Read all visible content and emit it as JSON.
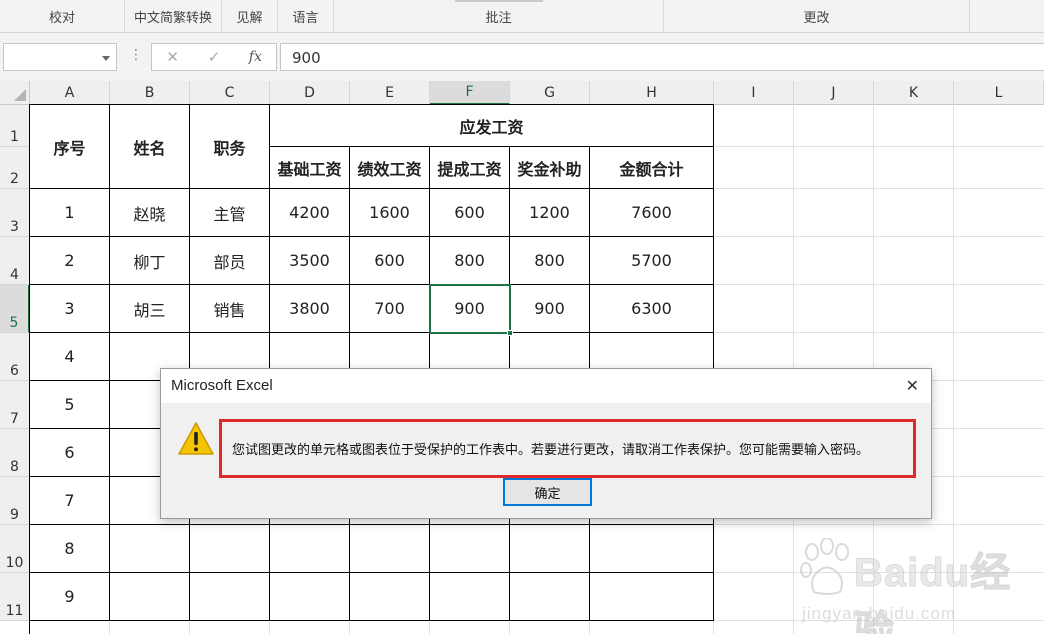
{
  "ribbon": {
    "groups": [
      "校对",
      "中文简繁转换",
      "见解",
      "语言",
      "批注",
      "更改"
    ]
  },
  "formula_bar": {
    "name_box": "",
    "cancel_symbol": "✕",
    "enter_symbol": "✓",
    "fx_symbol": "fx",
    "value": "900"
  },
  "columns": [
    "A",
    "B",
    "C",
    "D",
    "E",
    "F",
    "G",
    "H",
    "I",
    "J",
    "K",
    "L"
  ],
  "rows": [
    "1",
    "2",
    "3",
    "4",
    "5",
    "6",
    "7",
    "8",
    "9",
    "10",
    "11"
  ],
  "active_cell": {
    "column": "F",
    "row": "5"
  },
  "table": {
    "headers": {
      "seq": "序号",
      "name": "姓名",
      "role": "职务",
      "pay_group": "应发工资",
      "base": "基础工资",
      "perf": "绩效工资",
      "commission": "提成工资",
      "bonus": "奖金补助",
      "total": "金额合计"
    },
    "records": [
      {
        "seq": "1",
        "name": "赵晓",
        "role": "主管",
        "base": "4200",
        "perf": "1600",
        "commission": "600",
        "bonus": "1200",
        "total": "7600"
      },
      {
        "seq": "2",
        "name": "柳丁",
        "role": "部员",
        "base": "3500",
        "perf": "600",
        "commission": "800",
        "bonus": "800",
        "total": "5700"
      },
      {
        "seq": "3",
        "name": "胡三",
        "role": "销售",
        "base": "3800",
        "perf": "700",
        "commission": "900",
        "bonus": "900",
        "total": "6300"
      }
    ],
    "extra_seq": [
      "4",
      "5",
      "6",
      "7",
      "8",
      "9"
    ]
  },
  "dialog": {
    "title": "Microsoft Excel",
    "close_symbol": "✕",
    "icon": "warning-icon",
    "message": "您试图更改的单元格或图表位于受保护的工作表中。若要进行更改，请取消工作表保护。您可能需要输入密码。",
    "ok_label": "确定"
  },
  "watermark": {
    "brand": "Baidu经验",
    "url": "jingyan.baidu.com"
  },
  "colors": {
    "excel_green": "#217346",
    "highlight_red": "#e02a2a",
    "warning_yellow": "#f5c400"
  }
}
